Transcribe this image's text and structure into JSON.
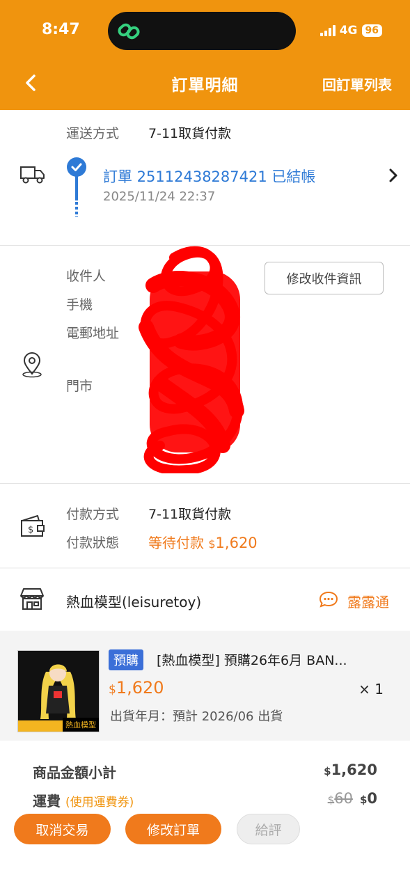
{
  "status_bar": {
    "time": "8:47",
    "network": "4G",
    "battery": "96"
  },
  "header": {
    "title": "訂單明細",
    "order_list_link": "回訂單列表"
  },
  "shipping": {
    "method_label": "運送方式",
    "method_value": "7-11取貨付款",
    "order_status": "訂單 25112438287421 已結帳",
    "order_time": "2025/11/24 22:37"
  },
  "recipient": {
    "name_label": "收件人",
    "phone_label": "手機",
    "email_label": "電郵地址",
    "store_label": "門市",
    "edit_button": "修改收件資訊"
  },
  "payment": {
    "method_label": "付款方式",
    "method_value": "7-11取貨付款",
    "status_label": "付款狀態",
    "status_value": "等待付款",
    "amount_currency": "$",
    "amount": "1,620"
  },
  "store": {
    "name": "熱血模型(leisuretoy)",
    "chat_label": "露露通"
  },
  "product": {
    "tag": "預購",
    "title": "[熱血模型] 預購26年6月 BAN...",
    "price_currency": "$",
    "price": "1,620",
    "quantity": "× 1",
    "ship_date": "出貨年月：預計 2026/06 出貨",
    "thumb_badge": "熱血模型"
  },
  "summary": {
    "subtotal_label": "商品金額小計",
    "subtotal_currency": "$",
    "subtotal_value": "1,620",
    "shipping_label": "運費",
    "shipping_note": "(使用運費券)",
    "shipping_original_currency": "$",
    "shipping_original": "60",
    "shipping_final_currency": "$",
    "shipping_final": "0"
  },
  "actions": {
    "cancel": "取消交易",
    "modify": "修改訂單",
    "review": "給評"
  },
  "colors": {
    "header": "#f0940e",
    "accent": "#f07a1c",
    "link_blue": "#2e7ad6",
    "redaction": "#ff0000"
  }
}
